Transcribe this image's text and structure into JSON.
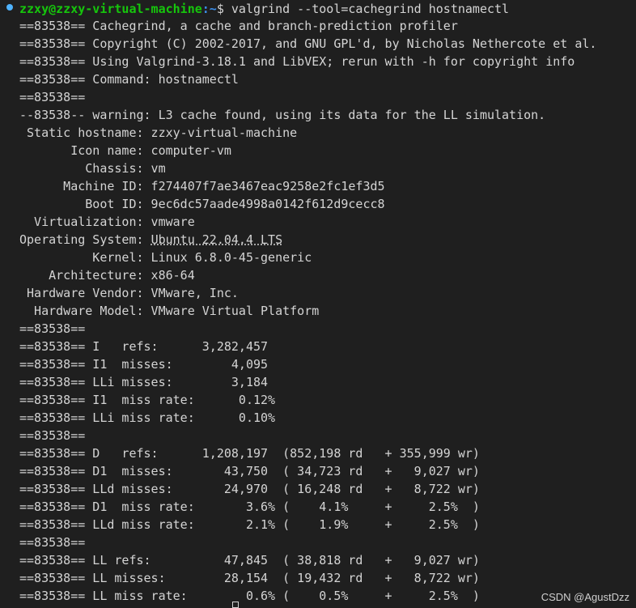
{
  "prompt": {
    "user_host": "zzxy@zzxy-virtual-machine",
    "path": ":~",
    "symbol": "$ ",
    "command": "valgrind --tool=cachegrind hostnamectl"
  },
  "lines": [
    "==83538== Cachegrind, a cache and branch-prediction profiler",
    "==83538== Copyright (C) 2002-2017, and GNU GPL'd, by Nicholas Nethercote et al.",
    "==83538== Using Valgrind-3.18.1 and LibVEX; rerun with -h for copyright info",
    "==83538== Command: hostnamectl",
    "==83538==",
    "--83538-- warning: L3 cache found, using its data for the LL simulation.",
    " Static hostname: zzxy-virtual-machine",
    "       Icon name: computer-vm",
    "         Chassis: vm",
    "      Machine ID: f274407f7ae3467eac9258e2fc1ef3d5",
    "         Boot ID: 9ec6dc57aade4998a0142f612d9cecc8",
    "  Virtualization: vmware",
    "Operating System: ",
    "          Kernel: Linux 6.8.0-45-generic",
    "    Architecture: x86-64",
    " Hardware Vendor: VMware, Inc.",
    "  Hardware Model: VMware Virtual Platform",
    "==83538==",
    "==83538== I   refs:      3,282,457",
    "==83538== I1  misses:        4,095",
    "==83538== LLi misses:        3,184",
    "==83538== I1  miss rate:      0.12%",
    "==83538== LLi miss rate:      0.10%",
    "==83538==",
    "==83538== D   refs:      1,208,197  (852,198 rd   + 355,999 wr)",
    "==83538== D1  misses:       43,750  ( 34,723 rd   +   9,027 wr)",
    "==83538== LLd misses:       24,970  ( 16,248 rd   +   8,722 wr)",
    "==83538== D1  miss rate:       3.6% (    4.1%     +     2.5%  )",
    "==83538== LLd miss rate:       2.1% (    1.9%     +     2.5%  )",
    "==83538==",
    "==83538== LL refs:          47,845  ( 38,818 rd   +   9,027 wr)",
    "==83538== LL misses:        28,154  ( 19,432 rd   +   8,722 wr)",
    "==83538== LL miss rate:        0.6% (    0.5%     +     2.5%  )"
  ],
  "os_value": "Ubuntu 22.04.4 LTS",
  "watermark": "CSDN @AgustDzz",
  "colors": {
    "background": "#1f1f1f",
    "text": "#d4d4d4",
    "user_host": "#16c60c",
    "path": "#3b8eea",
    "dot": "#4fb3ff"
  }
}
